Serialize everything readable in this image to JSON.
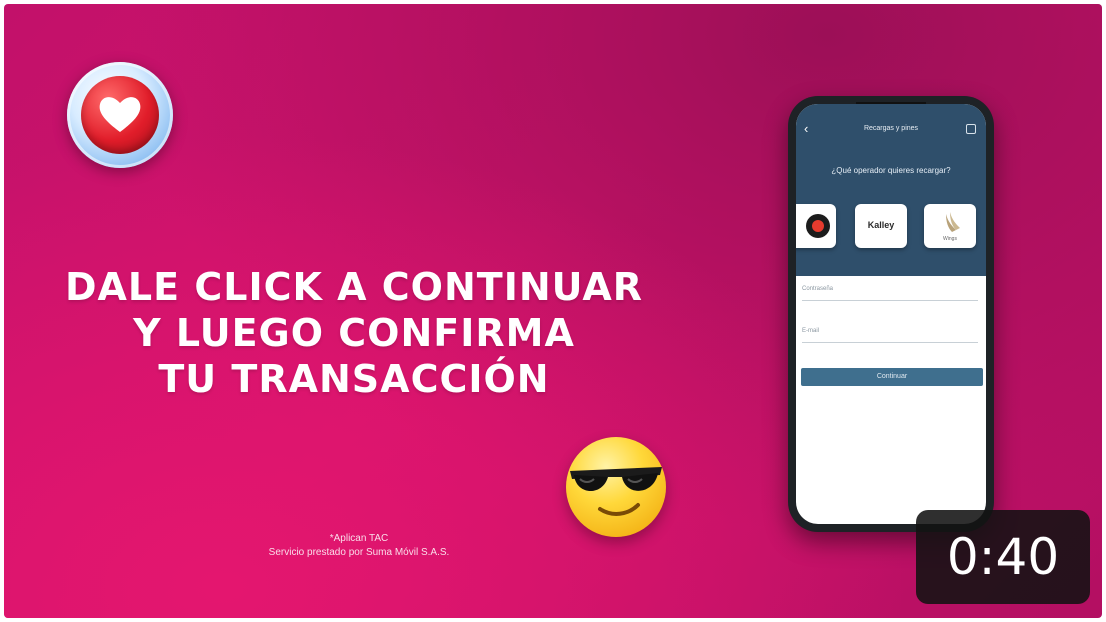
{
  "video": {
    "headline_lines": [
      "DALE CLICK A CONTINUAR",
      "Y LUEGO CONFIRMA",
      "TU TRANSACCIÓN"
    ],
    "disclaimer_lines": [
      "*Aplican TAC",
      "Servicio prestado por Suma Móvil S.A.S."
    ],
    "logo_icon": "heart-badge-icon",
    "emoji_icon": "sunglasses-emoji-icon",
    "colors": {
      "background": "#c2116a",
      "app_header": "#2f4f6b",
      "button": "#3f6f8e"
    }
  },
  "phone": {
    "app_title": "Recargas y pines",
    "question": "¿Qué operador quieres recargar?",
    "operators": [
      "",
      "Kalley",
      "Wings"
    ],
    "form": {
      "field1_label": "Contraseña",
      "field2_label": "E-mail",
      "continue_label": "Continuar"
    }
  },
  "duration": "0:40"
}
